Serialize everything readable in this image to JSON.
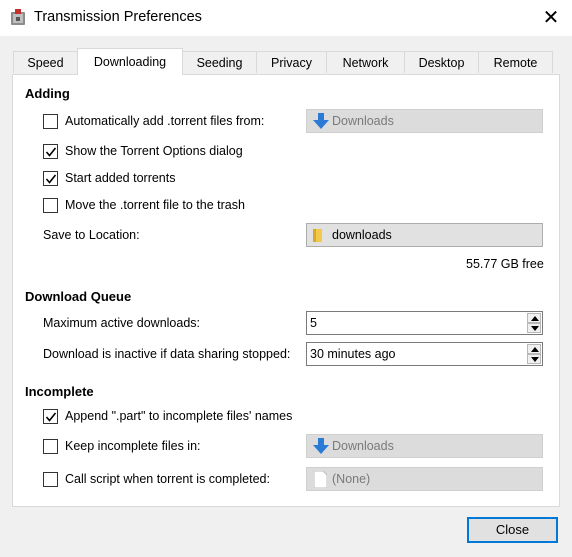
{
  "window": {
    "title": "Transmission Preferences",
    "close_glyph": "✕"
  },
  "tabs": [
    {
      "label": "Speed"
    },
    {
      "label": "Downloading"
    },
    {
      "label": "Seeding"
    },
    {
      "label": "Privacy"
    },
    {
      "label": "Network"
    },
    {
      "label": "Desktop"
    },
    {
      "label": "Remote"
    }
  ],
  "active_tab": "Downloading",
  "adding": {
    "heading": "Adding",
    "auto_add": {
      "label": "Automatically add .torrent files from:",
      "checked": false,
      "folder": "Downloads",
      "icon": "download-arrow-icon",
      "enabled": false
    },
    "show_options": {
      "label": "Show the Torrent Options dialog",
      "checked": true
    },
    "start_added": {
      "label": "Start added torrents",
      "checked": true
    },
    "move_to_trash": {
      "label": "Move the .torrent file to the trash",
      "checked": false
    },
    "save_location": {
      "label": "Save to Location:",
      "folder": "downloads",
      "icon": "folder-icon"
    },
    "free_space": "55.77 GB free"
  },
  "queue": {
    "heading": "Download Queue",
    "max_active": {
      "label": "Maximum active downloads:",
      "value": "5"
    },
    "inactive": {
      "label": "Download is inactive if data sharing stopped:",
      "value": "30 minutes ago"
    }
  },
  "incomplete": {
    "heading": "Incomplete",
    "append_part": {
      "label": "Append \".part\" to incomplete files' names",
      "checked": true
    },
    "keep_incomplete": {
      "label": "Keep incomplete files in:",
      "checked": false,
      "folder": "Downloads",
      "icon": "download-arrow-icon",
      "enabled": false
    },
    "call_script": {
      "label": "Call script when torrent is completed:",
      "checked": false,
      "file": "(None)",
      "icon": "file-icon",
      "enabled": false
    }
  },
  "footer": {
    "close_label": "Close"
  },
  "colors": {
    "accent": "#0078d7",
    "download_arrow": "#2b7bd6",
    "folder": "#f3c94c"
  }
}
